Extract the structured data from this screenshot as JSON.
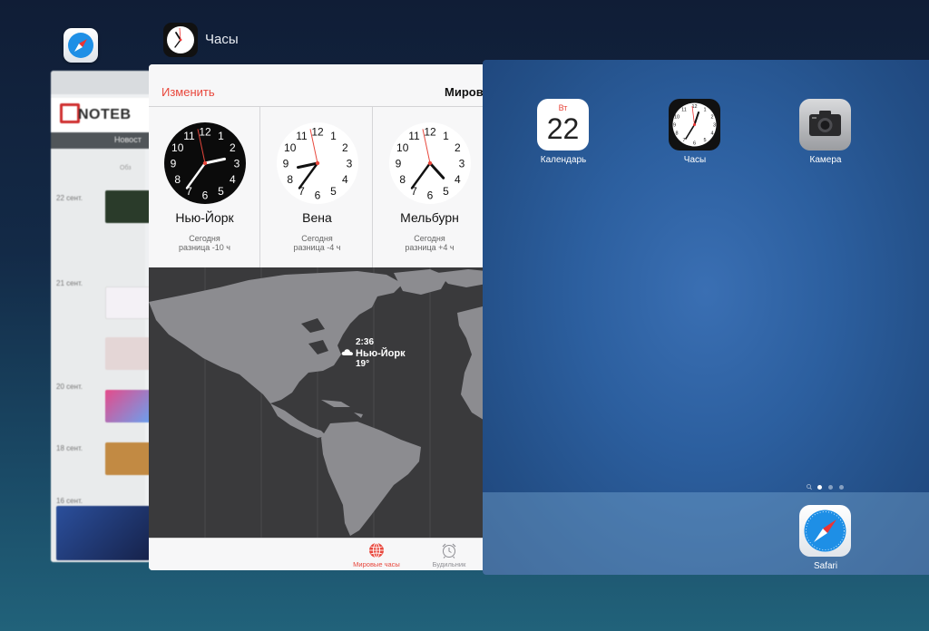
{
  "switcher": {
    "clock_header_title": "Часы"
  },
  "safari_card": {
    "logo_text": "NOTEB",
    "nav_text": "Новост",
    "obzor": "Обз",
    "dates": [
      "22 сент.",
      "21 сент.",
      "20 сент.",
      "18 сент.",
      "16 сент."
    ]
  },
  "clock_app": {
    "edit_label": "Изменить",
    "nav_title": "Мировые часы",
    "cities": [
      {
        "name": "Нью-Йорк",
        "day": "Сегодня",
        "diff": "разница -10 ч",
        "dark": true,
        "hour": 2,
        "minute": 36,
        "second": 58
      },
      {
        "name": "Вена",
        "day": "Сегодня",
        "diff": "разница -4 ч",
        "dark": false,
        "hour": 8,
        "minute": 36,
        "second": 58
      },
      {
        "name": "Мельбурн",
        "day": "Сегодня",
        "diff": "разница +4 ч",
        "dark": false,
        "hour": 4,
        "minute": 36,
        "second": 58
      }
    ],
    "map": {
      "time": "2:36",
      "city": "Нью-Йорк",
      "temp": "19°",
      "weather_icon": "cloud-icon"
    },
    "tabs": [
      {
        "label": "Мировые часы",
        "icon": "globe-icon",
        "active": true
      },
      {
        "label": "Будильник",
        "icon": "alarm-clock-icon",
        "active": false
      }
    ],
    "accent": "#e8473c"
  },
  "home_screen": {
    "apps": [
      {
        "label": "Календарь",
        "icon": "calendar-icon",
        "weekday": "Вт",
        "day": "22"
      },
      {
        "label": "Часы",
        "icon": "clock-icon"
      },
      {
        "label": "Камера",
        "icon": "camera-icon"
      }
    ],
    "dock_apps": [
      {
        "label": "Safari",
        "icon": "safari-compass-icon"
      }
    ]
  }
}
